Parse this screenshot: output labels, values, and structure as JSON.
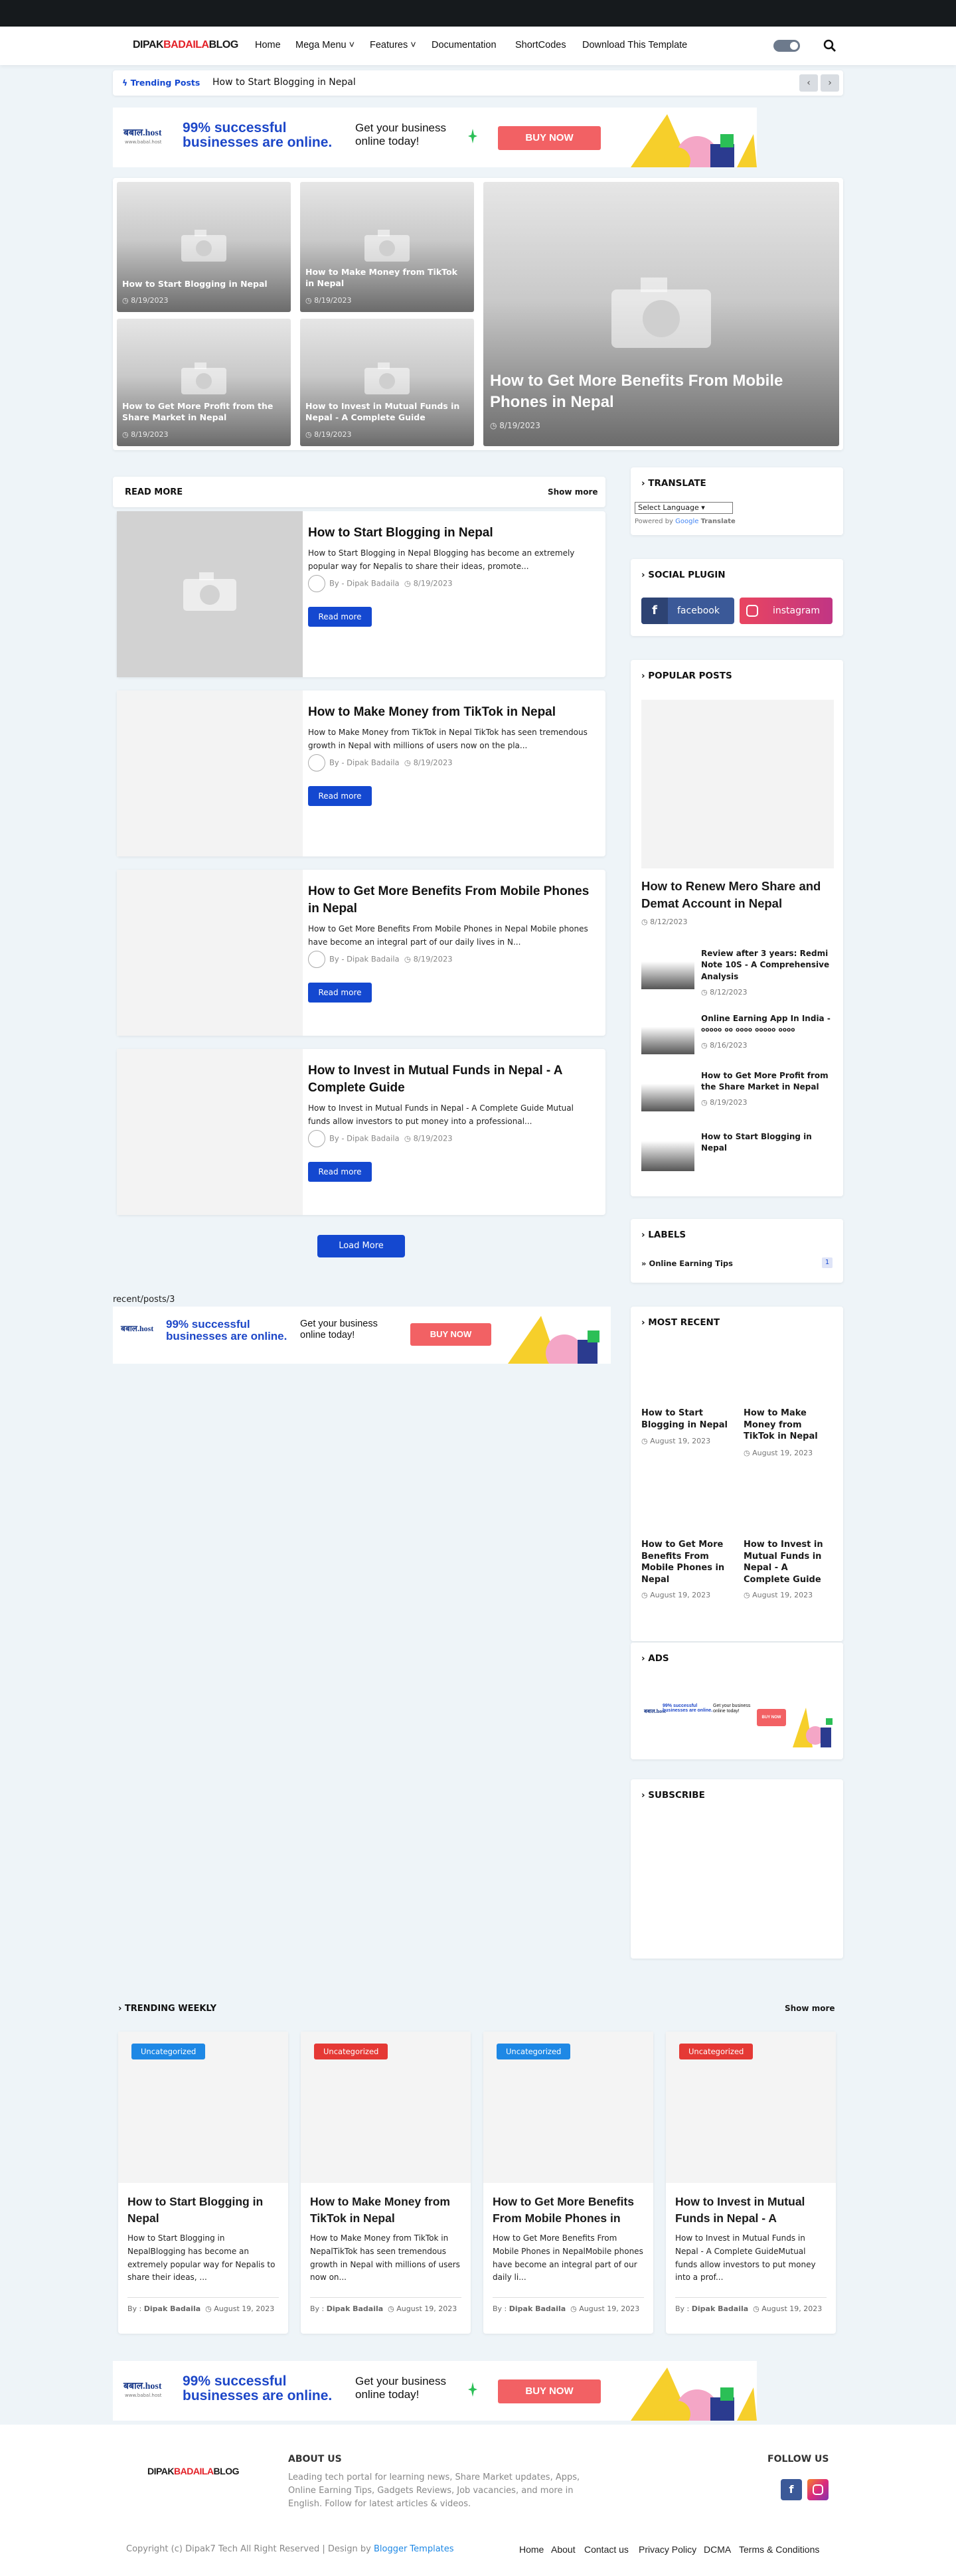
{
  "header": {
    "logo_a": "DIPAK",
    "logo_b": "BADAILA",
    "logo_c": "BLOG",
    "nav": [
      "Home",
      "Mega Menu",
      "Features",
      "Documentation",
      "ShortCodes",
      "Download This Template"
    ]
  },
  "trending": {
    "label": "Trending Posts",
    "text": "How to Start Blogging in Nepal"
  },
  "banner": {
    "brand": "बबाल.host",
    "sub": "www.babal.host",
    "h1a": "99% successful",
    "h1b": "businesses are online.",
    "h2a": "Get your business",
    "h2b": "online today!",
    "buy": "BUY NOW"
  },
  "featured": [
    {
      "title": "How to Start Blogging in Nepal",
      "date": "8/19/2023"
    },
    {
      "title": "How to Make Money from TikTok in Nepal",
      "date": "8/19/2023"
    },
    {
      "title": "How to Get More Benefits From Mobile Phones in Nepal",
      "date": "8/19/2023"
    },
    {
      "title": "How to Get More Profit from the Share Market in Nepal",
      "date": "8/19/2023"
    },
    {
      "title": "How to Invest in Mutual Funds in Nepal - A Complete Guide",
      "date": "8/19/2023"
    }
  ],
  "readmore": {
    "title": "READ MORE",
    "show": "Show more",
    "load": "Load More",
    "label": "Read more",
    "by": "By - Dipak Badaila"
  },
  "posts": [
    {
      "title": "How to Start Blogging in Nepal",
      "excerpt": "How to Start Blogging in Nepal Blogging has become an extremely popular way for Nepalis to share their ideas, promote...",
      "date": "8/19/2023"
    },
    {
      "title": "How to Make Money from TikTok in Nepal",
      "excerpt": "How to Make Money from TikTok in Nepal TikTok has seen tremendous growth in Nepal with millions of users now on the pla...",
      "date": "8/19/2023"
    },
    {
      "title": "How to Get More Benefits From Mobile Phones in Nepal",
      "excerpt": "How to Get More Benefits From Mobile Phones in Nepal Mobile phones have become an integral part of our daily lives in N...",
      "date": "8/19/2023"
    },
    {
      "title": "How to Invest in Mutual Funds in Nepal - A Complete Guide",
      "excerpt": "How to Invest in Mutual Funds in Nepal - A Complete Guide Mutual funds allow investors to put money into a professional...",
      "date": "8/19/2023"
    }
  ],
  "recent_label": "recent/posts/3",
  "sidebar": {
    "translate": {
      "title": "TRANSLATE",
      "select": "Select Language",
      "powered": "Powered by",
      "google": "Google",
      "tr": "Translate"
    },
    "social": {
      "title": "SOCIAL PLUGIN",
      "facebook": "facebook",
      "instagram": "instagram"
    },
    "popular": {
      "title": "POPULAR POSTS",
      "main_title": "How to Renew Mero Share and Demat Account in Nepal",
      "main_date": "8/12/2023",
      "items": [
        {
          "title": "Review after 3 years: Redmi Note 10S - A Comprehensive Analysis",
          "date": "8/12/2023"
        },
        {
          "title": "Online Earning App In India - ००००० ०० ०००० ००००० ००००",
          "date": "8/16/2023"
        },
        {
          "title": "How to Get More Profit from the Share Market in Nepal",
          "date": "8/19/2023"
        },
        {
          "title": "How to Start Blogging in Nepal",
          "date": ""
        }
      ]
    },
    "labels": {
      "title": "LABELS",
      "item": "Online Earning Tips",
      "count": "1"
    },
    "recent": {
      "title": "MOST RECENT",
      "items": [
        {
          "title": "How to Start Blogging in Nepal",
          "date": "August 19, 2023"
        },
        {
          "title": "How to Make Money from TikTok in Nepal",
          "date": "August 19, 2023"
        },
        {
          "title": "How to Get More Benefits From Mobile Phones in Nepal",
          "date": "August 19, 2023"
        },
        {
          "title": "How to Invest in Mutual Funds in Nepal - A Complete Guide",
          "date": "August 19, 2023"
        }
      ]
    },
    "ads": {
      "title": "ADS"
    },
    "subscribe": {
      "title": "SUBSCRIBE"
    }
  },
  "weekly": {
    "title": "TRENDING WEEKLY",
    "show": "Show more",
    "badge": "Uncategorized",
    "author": "Dipak Badaila",
    "by": "By :",
    "date": "August 19, 2023",
    "items": [
      {
        "title": "How to Start Blogging in Nepal",
        "excerpt": "How to Start Blogging in NepalBlogging has become an extremely popular way for Nepalis to share their ideas, ...",
        "color": "#1e88e5"
      },
      {
        "title": "How to Make Money from TikTok in Nepal",
        "excerpt": "How to Make Money from TikTok in NepalTikTok has seen tremendous growth in Nepal with millions of users now on...",
        "color": "#e53935"
      },
      {
        "title": "How to Get More Benefits From Mobile Phones in Nepal",
        "excerpt": "How to Get More Benefits From Mobile Phones in NepalMobile phones have become an integral part of our daily li...",
        "color": "#1e88e5"
      },
      {
        "title": "How to Invest in Mutual Funds in Nepal - A Complete Guide",
        "excerpt": "How to Invest in Mutual Funds in Nepal - A Complete GuideMutual funds allow investors to put money into a prof...",
        "color": "#e53935"
      }
    ]
  },
  "footer": {
    "about_title": "ABOUT US",
    "about": "Leading tech portal for learning news, Share Market updates, Apps, Online Earning Tips, Gadgets Reviews, Job vacancies, and more in English. Follow for latest articles & videos.",
    "follow": "FOLLOW US",
    "copy": "Copyright (c) Dipak7 Tech All Right Reserved | Design by",
    "design": "Blogger Templates",
    "links": [
      "Home",
      "About",
      "Contact us",
      "Privacy Policy",
      "DCMA",
      "Terms & Conditions"
    ]
  }
}
